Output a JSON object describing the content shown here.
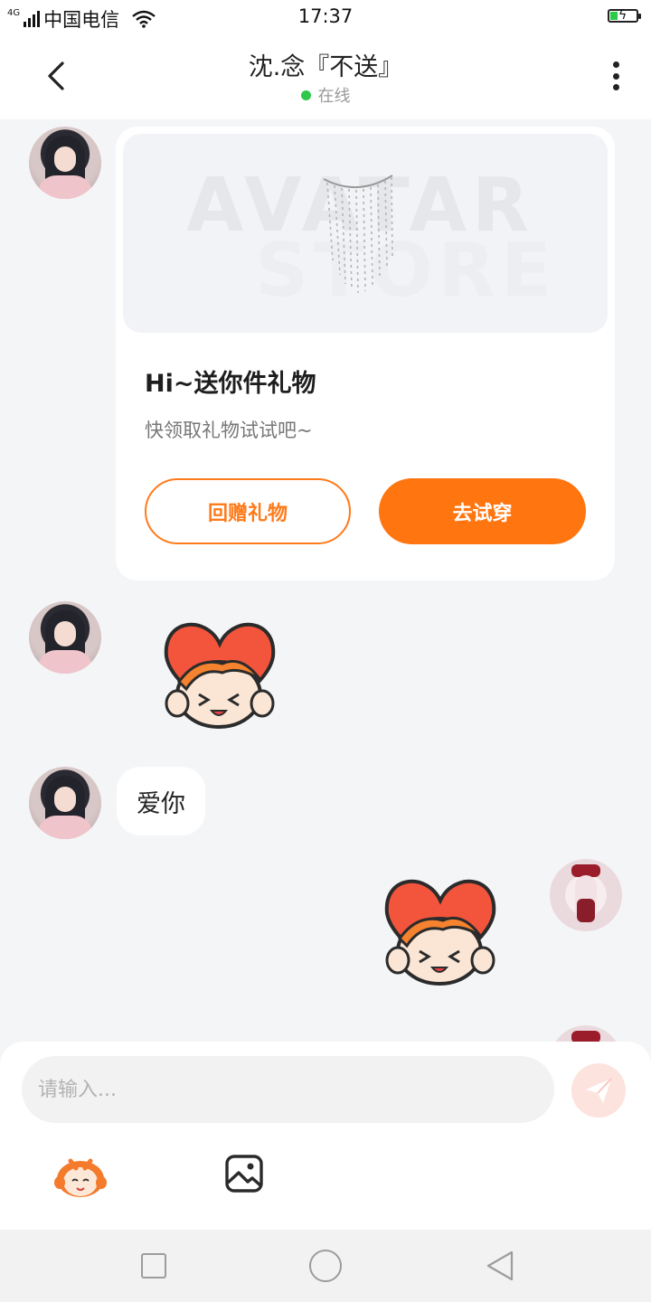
{
  "status_bar": {
    "network": "4G",
    "carrier": "中国电信",
    "time": "17:37",
    "icons": [
      "signal-icon",
      "wifi-icon",
      "battery-charging-icon"
    ]
  },
  "header": {
    "title": "沈.念『不送』",
    "status": "在线",
    "status_color": "#2ec84a",
    "icons": [
      "back-arrow-icon",
      "more-vertical-icon"
    ]
  },
  "messages": [
    {
      "side": "left",
      "type": "gift-card",
      "preview_watermark": [
        "AVATAR",
        "STORE"
      ],
      "title": "Hi~送你件礼物",
      "subtitle": "快领取礼物试试吧~",
      "buttons": [
        "回赠礼物",
        "去试穿"
      ]
    },
    {
      "side": "left",
      "type": "sticker",
      "sticker": "love-heart-sticker"
    },
    {
      "side": "left",
      "type": "text",
      "text": "爱你"
    },
    {
      "side": "right",
      "type": "sticker",
      "sticker": "love-heart-sticker"
    }
  ],
  "composer": {
    "placeholder": "请输入...",
    "value": "",
    "icons": [
      "send-icon",
      "sticker-icon",
      "image-icon"
    ]
  },
  "nav_bar": {
    "icons": [
      "recent-apps-icon",
      "home-icon",
      "back-icon"
    ]
  },
  "colors": {
    "accent": "#ff7510",
    "background": "#f4f5f7",
    "card": "#ffffff",
    "send_button": "#fde3de"
  }
}
